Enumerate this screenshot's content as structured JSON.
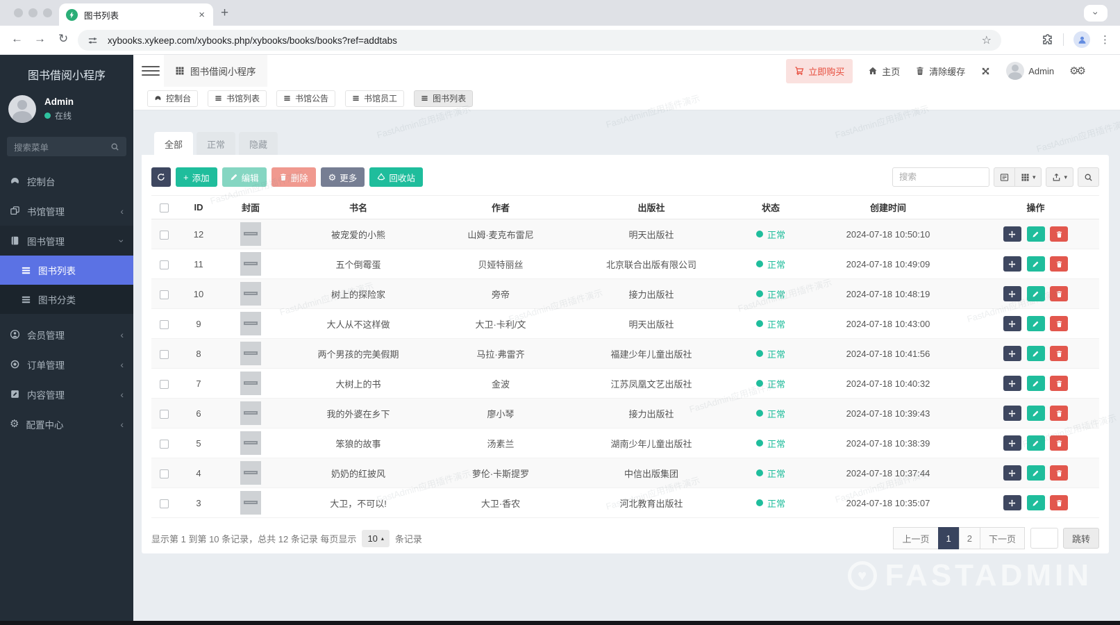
{
  "browser": {
    "tab_title": "图书列表",
    "url": "xybooks.xykeep.com/xybooks.php/xybooks/books/books?ref=addtabs"
  },
  "sidebar": {
    "app_title": "图书借阅小程序",
    "user": {
      "name": "Admin",
      "status": "在线"
    },
    "search_placeholder": "搜索菜单",
    "items": [
      {
        "label": "控制台",
        "icon": "gauge-icon"
      },
      {
        "label": "书馆管理",
        "icon": "windows-icon"
      },
      {
        "label": "图书管理",
        "icon": "book-icon"
      },
      {
        "label": "图书列表",
        "icon": "list-icon"
      },
      {
        "label": "图书分类",
        "icon": "list-icon"
      },
      {
        "label": "会员管理",
        "icon": "user-icon"
      },
      {
        "label": "订单管理",
        "icon": "circle-icon"
      },
      {
        "label": "内容管理",
        "icon": "edit-square-icon"
      },
      {
        "label": "配置中心",
        "icon": "gear-icon"
      }
    ]
  },
  "topbar": {
    "app_title": "图书借阅小程序",
    "buy_label": "立即购买",
    "home_label": "主页",
    "clear_cache_label": "清除缓存",
    "user_name": "Admin"
  },
  "nav_tabs": [
    {
      "label": "控制台",
      "icon": "gauge-icon"
    },
    {
      "label": "书馆列表",
      "icon": "list-icon"
    },
    {
      "label": "书馆公告",
      "icon": "list-icon"
    },
    {
      "label": "书馆员工",
      "icon": "list-icon"
    },
    {
      "label": "图书列表",
      "icon": "list-icon",
      "active": true
    }
  ],
  "filter_tabs": [
    {
      "label": "全部",
      "active": true
    },
    {
      "label": "正常"
    },
    {
      "label": "隐藏"
    }
  ],
  "toolbar": {
    "add_label": "添加",
    "edit_label": "编辑",
    "delete_label": "删除",
    "more_label": "更多",
    "recycle_label": "回收站",
    "search_placeholder": "搜索"
  },
  "table": {
    "headers": [
      "ID",
      "封面",
      "书名",
      "作者",
      "出版社",
      "状态",
      "创建时间",
      "操作"
    ],
    "rows": [
      {
        "id": "12",
        "title": "被宠爱的小熊",
        "author": "山姆·麦克布雷尼",
        "publisher": "明天出版社",
        "status": "正常",
        "created": "2024-07-18 10:50:10"
      },
      {
        "id": "11",
        "title": "五个倒霉蛋",
        "author": "贝娅特丽丝",
        "publisher": "北京联合出版有限公司",
        "status": "正常",
        "created": "2024-07-18 10:49:09"
      },
      {
        "id": "10",
        "title": "树上的探险家",
        "author": "旁帝",
        "publisher": "接力出版社",
        "status": "正常",
        "created": "2024-07-18 10:48:19"
      },
      {
        "id": "9",
        "title": "大人从不这样做",
        "author": "大卫·卡利/文",
        "publisher": "明天出版社",
        "status": "正常",
        "created": "2024-07-18 10:43:00"
      },
      {
        "id": "8",
        "title": "两个男孩的完美假期",
        "author": "马拉·弗雷齐",
        "publisher": "福建少年儿童出版社",
        "status": "正常",
        "created": "2024-07-18 10:41:56"
      },
      {
        "id": "7",
        "title": "大树上的书",
        "author": "金波",
        "publisher": "江苏凤凰文艺出版社",
        "status": "正常",
        "created": "2024-07-18 10:40:32"
      },
      {
        "id": "6",
        "title": "我的外婆在乡下",
        "author": "廖小琴",
        "publisher": "接力出版社",
        "status": "正常",
        "created": "2024-07-18 10:39:43"
      },
      {
        "id": "5",
        "title": "笨狼的故事",
        "author": "汤素兰",
        "publisher": "湖南少年儿童出版社",
        "status": "正常",
        "created": "2024-07-18 10:38:39"
      },
      {
        "id": "4",
        "title": "奶奶的红披风",
        "author": "萝伦·卡斯提罗",
        "publisher": "中信出版集团",
        "status": "正常",
        "created": "2024-07-18 10:37:44"
      },
      {
        "id": "3",
        "title": "大卫，不可以!",
        "author": "大卫·香农",
        "publisher": "河北教育出版社",
        "status": "正常",
        "created": "2024-07-18 10:35:07"
      }
    ]
  },
  "pagination": {
    "summary_prefix": "显示第 1 到第 10 条记录，总共 12 条记录 每页显示",
    "page_size": "10",
    "summary_suffix": "条记录",
    "prev_label": "上一页",
    "pages": [
      "1",
      "2"
    ],
    "active_page": "1",
    "next_label": "下一页",
    "jump_label": "跳转"
  },
  "watermark": {
    "tile_text": "FastAdmin应用插件演示",
    "brand_text": "FASTADMIN"
  },
  "colors": {
    "accent_green": "#1fbd9c",
    "accent_navy": "#3e4760",
    "accent_red": "#e2574d",
    "active_menu_blue": "#5b72e4",
    "buy_red": "#e74c3c"
  }
}
